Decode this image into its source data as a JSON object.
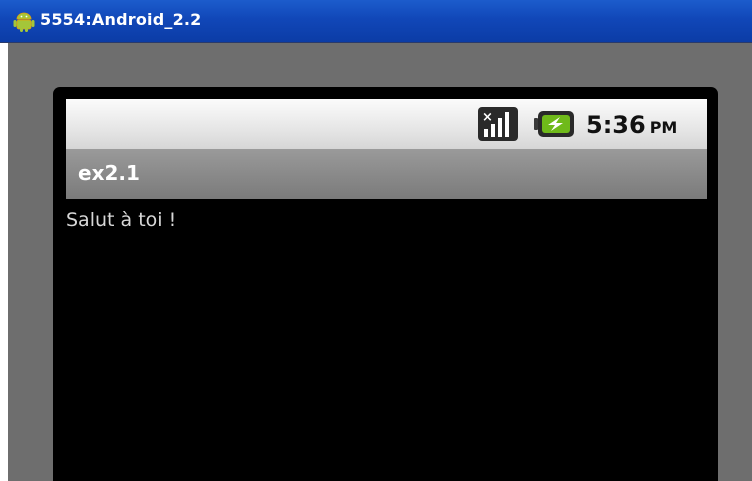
{
  "window": {
    "title": "5554:Android_2.2",
    "icon": "android-icon"
  },
  "status_bar": {
    "signal_icon": "no-signal-icon",
    "battery_icon": "battery-charging-icon",
    "time": "5:36",
    "ampm": "PM"
  },
  "app": {
    "title": "ex2.1",
    "message": "Salut à toi !"
  },
  "colors": {
    "titlebar": "#1147b8",
    "frame": "#6e6e6e",
    "app_bar": "#8a8a8a",
    "battery_green": "#5a9a10"
  }
}
